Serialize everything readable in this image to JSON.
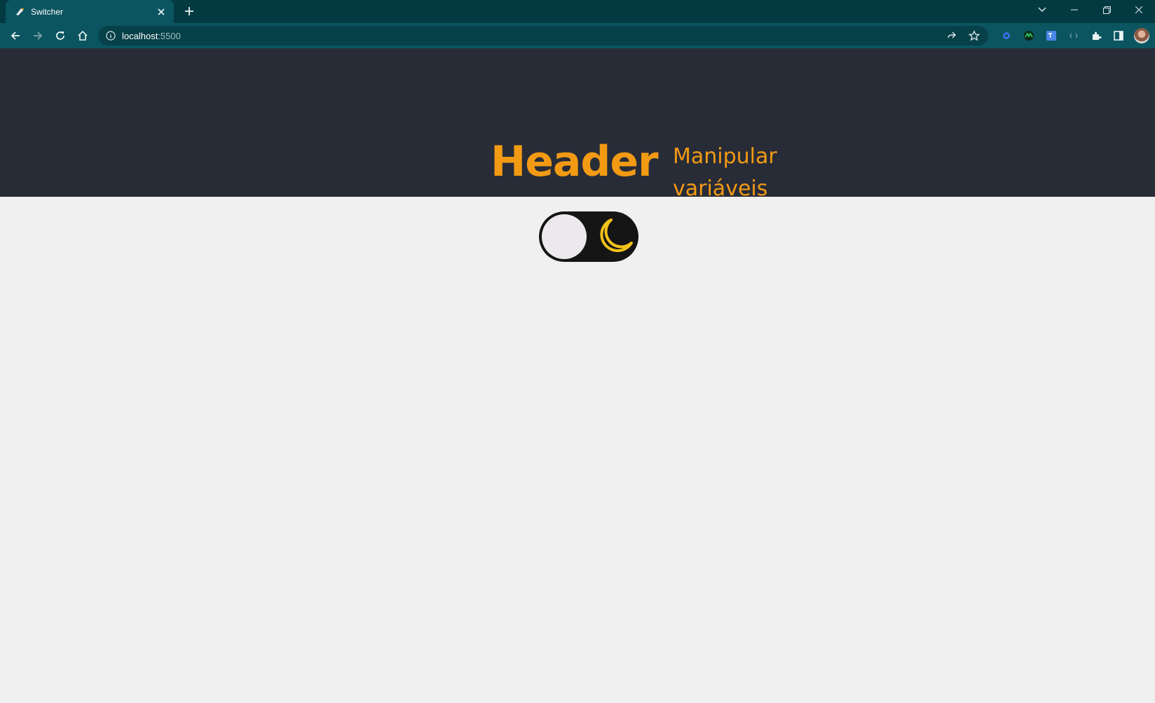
{
  "browser": {
    "tab": {
      "title": "Switcher"
    },
    "address": {
      "host": "localhost",
      "port": ":5500"
    }
  },
  "page": {
    "header": {
      "title": "Header",
      "subtitle": "Manipular variáveis"
    },
    "theme_switch": {
      "state": "off",
      "icon": "moon-icon"
    }
  },
  "colors": {
    "header_bg": "#282c37",
    "accent": "#f29a13",
    "body_bg": "#f0f0f0",
    "switch_bg": "#151515",
    "moon": "#f2c21a"
  }
}
